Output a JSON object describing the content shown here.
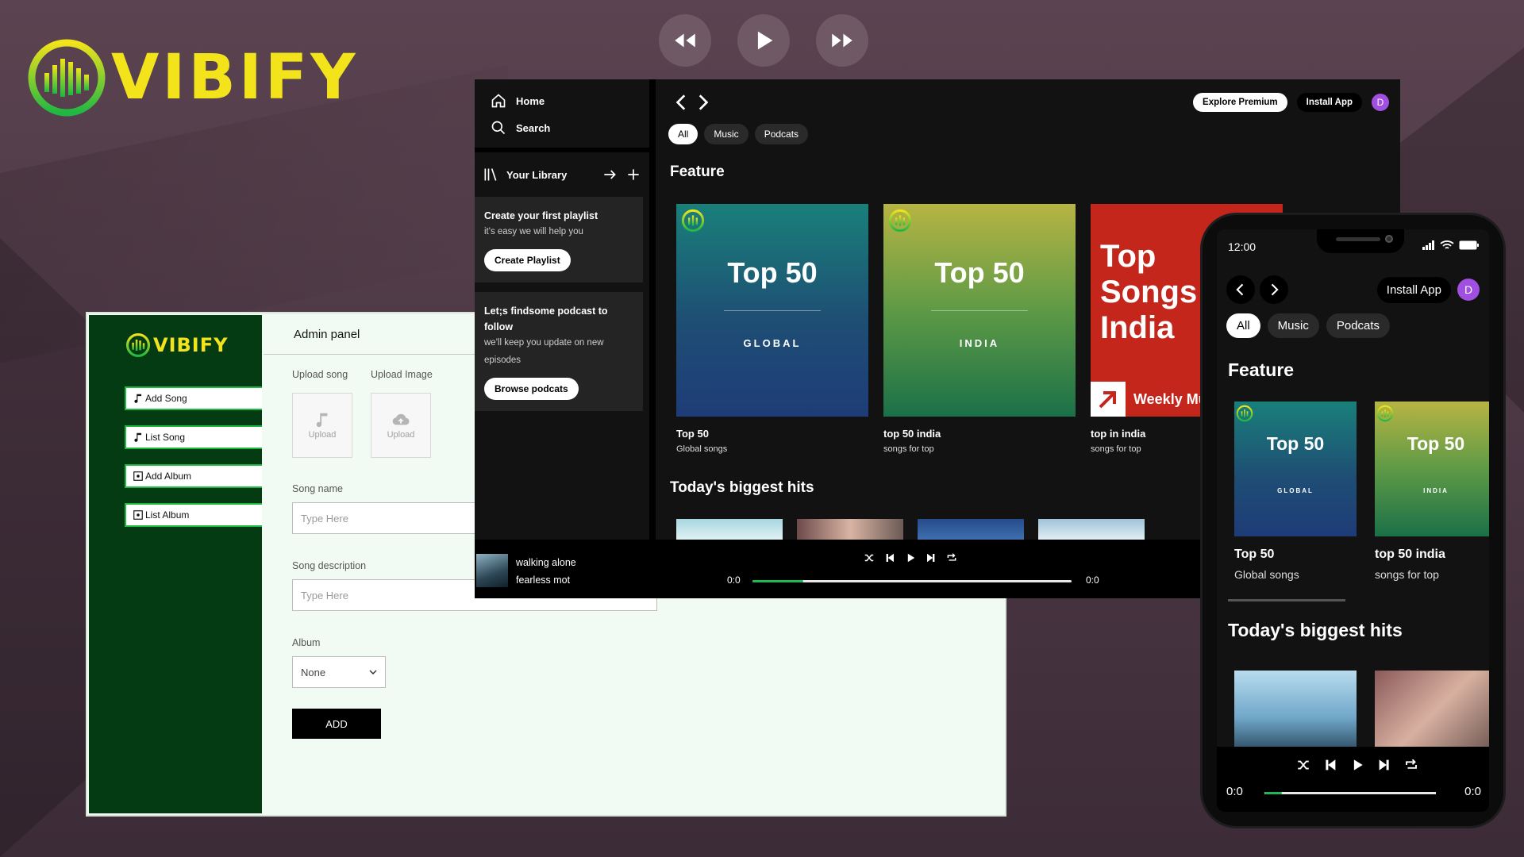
{
  "brand": {
    "name": "VIBIFY",
    "color": "#f2e31b"
  },
  "top_controls": [
    "rewind-icon",
    "play-icon",
    "fast-forward-icon"
  ],
  "admin": {
    "logo": "VIBIFY",
    "header": "Admin panel",
    "menu": [
      {
        "label": "Add Song",
        "icon": "music-note-icon"
      },
      {
        "label": "List Song",
        "icon": "music-note-icon"
      },
      {
        "label": "Add Album",
        "icon": "album-icon"
      },
      {
        "label": "List Album",
        "icon": "album-icon"
      }
    ],
    "upload_song_label": "Upload song",
    "upload_image_label": "Upload Image",
    "upload_text": "Upload",
    "song_name_label": "Song name",
    "song_name_placeholder": "Type Here",
    "song_desc_label": "Song description",
    "song_desc_placeholder": "Type Here",
    "album_label": "Album",
    "album_value": "None",
    "add_label": "ADD",
    "side_color": "#053b13",
    "accent": "#1fb842"
  },
  "desktop": {
    "nav": {
      "home": "Home",
      "search": "Search"
    },
    "library": {
      "title": "Your Library",
      "card1": {
        "heading": "Create your first playlist",
        "sub": "it's easy we will help you",
        "button": "Create Playlist"
      },
      "card2": {
        "heading": "Let;s findsome podcast to follow",
        "sub": "we'll keep you update on new episodes",
        "button": "Browse podcats"
      }
    },
    "header": {
      "premium": "Explore Premium",
      "install": "Install App",
      "avatar": "D"
    },
    "chips": [
      "All",
      "Music",
      "Podcats"
    ],
    "feature_title": "Feature",
    "feature_cards": [
      {
        "cover_title": "Top 50",
        "cover_sub": "GLOBAL",
        "title": "Top 50",
        "desc": "Global songs"
      },
      {
        "cover_title": "Top 50",
        "cover_sub": "INDIA",
        "title": "top 50 india",
        "desc": "songs for top"
      },
      {
        "cover_title": "Top Songs India",
        "cover_sub": "Weekly Mu",
        "title": "top in india",
        "desc": "songs for top"
      }
    ],
    "hits_title": "Today's biggest hits",
    "now_playing": {
      "title": "walking alone",
      "artist": "fearless mot"
    },
    "time_current": "0:0",
    "time_total": "0:0",
    "progress": 0.16
  },
  "phone": {
    "time": "12:00",
    "install": "Install App",
    "avatar": "D",
    "chips": [
      "All",
      "Music",
      "Podcats"
    ],
    "feature_title": "Feature",
    "cards": [
      {
        "cover_title": "Top 50",
        "cover_sub": "GLOBAL",
        "title": "Top 50",
        "desc": "Global songs"
      },
      {
        "cover_title": "Top 50",
        "cover_sub": "INDIA",
        "title": "top 50 india",
        "desc": "songs for top"
      }
    ],
    "hits_title": "Today's biggest hits",
    "time_current": "0:0",
    "time_total": "0:0",
    "progress": 0.1
  }
}
